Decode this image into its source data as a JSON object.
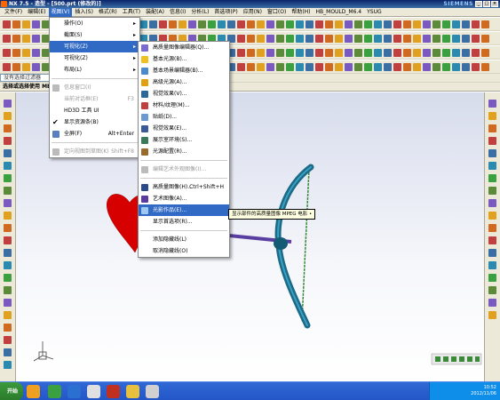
{
  "window": {
    "title": "NX 7.5 - 造型 - [500.prt (修改的)]",
    "brand": "SIEMENS",
    "controls": [
      "_",
      "□",
      "×"
    ]
  },
  "menubar": [
    "文件(F)",
    "编辑(E)",
    "视图(V)",
    "插入(S)",
    "格式(R)",
    "工具(T)",
    "装配(A)",
    "信息(I)",
    "分析(L)",
    "首选项(P)",
    "应用(N)",
    "窗口(O)",
    "帮助(H)",
    "HB_MOULD_M6.4",
    "YSUG"
  ],
  "filter": {
    "placeholder": "没有选择过滤器"
  },
  "selection_bar": "选择或选择使用 ME",
  "view_menu": {
    "items": [
      {
        "label": "操作(O)",
        "arrow": "▸",
        "disabled": false
      },
      {
        "label": "截面(S)",
        "arrow": "▸",
        "disabled": false
      },
      {
        "label": "可视化(Z)",
        "arrow": "▸",
        "disabled": false,
        "highlighted": true
      },
      {
        "label": "可视化(Z)",
        "arrow": "▸",
        "disabled": false
      },
      {
        "label": "布局(L)",
        "arrow": "▸",
        "disabled": false
      },
      {
        "label": "信息窗口(I)",
        "disabled": true
      },
      {
        "label": "当前对话框(E)",
        "shortcut": "F3",
        "disabled": true
      },
      {
        "label": "HD3D 工具 UI",
        "disabled": false
      },
      {
        "label": "显示资源条(B)",
        "disabled": false,
        "checked": true
      },
      {
        "label": "全屏(F)",
        "shortcut": "Alt+Enter",
        "disabled": false
      },
      {
        "label": "定向视图到草图(K)",
        "shortcut": "Shift+F8",
        "disabled": true
      }
    ]
  },
  "visualization_submenu": {
    "items": [
      {
        "label": "高质量图像编辑器(Q)...",
        "disabled": false
      },
      {
        "label": "基本光源(B)...",
        "disabled": false
      },
      {
        "label": "基本场景编辑器(B)...",
        "disabled": false
      },
      {
        "label": "高级光源(A)...",
        "disabled": false
      },
      {
        "label": "视觉效果(V)...",
        "disabled": false
      },
      {
        "label": "材料/纹理(M)...",
        "disabled": false
      },
      {
        "label": "贴纸(D)...",
        "disabled": false
      },
      {
        "label": "视觉效果(E)...",
        "disabled": false
      },
      {
        "label": "展示室环境(S)...",
        "disabled": false
      },
      {
        "label": "光源配置(R)...",
        "disabled": false
      },
      {
        "label": "编辑艺术外观图像(I)...",
        "disabled": true
      },
      {
        "label": "高质量图像(H)...",
        "shortcut": "Ctrl+Shift+H",
        "disabled": false
      },
      {
        "label": "艺术图像(A)...",
        "disabled": false
      },
      {
        "label": "光影作品(E)...",
        "disabled": false,
        "highlighted": true
      },
      {
        "label": "显示首选项(R)...",
        "disabled": false
      },
      {
        "label": "添加隐藏线(L)",
        "disabled": false
      },
      {
        "label": "取消隐藏线(O)",
        "disabled": false
      }
    ]
  },
  "tooltip": "显示部件的高质量图像 MPEG 电影 •",
  "taskbar": {
    "start_label": "开始",
    "clock_time": "10:52",
    "clock_date": "2012/11/06"
  },
  "colors": {
    "titlebar": "#0a246a",
    "menu_highlight": "#316ac5",
    "bow": "#1b6a86",
    "string": "#3a8a3a",
    "arrow": "#5b3fa0",
    "heart": "#d60000"
  }
}
